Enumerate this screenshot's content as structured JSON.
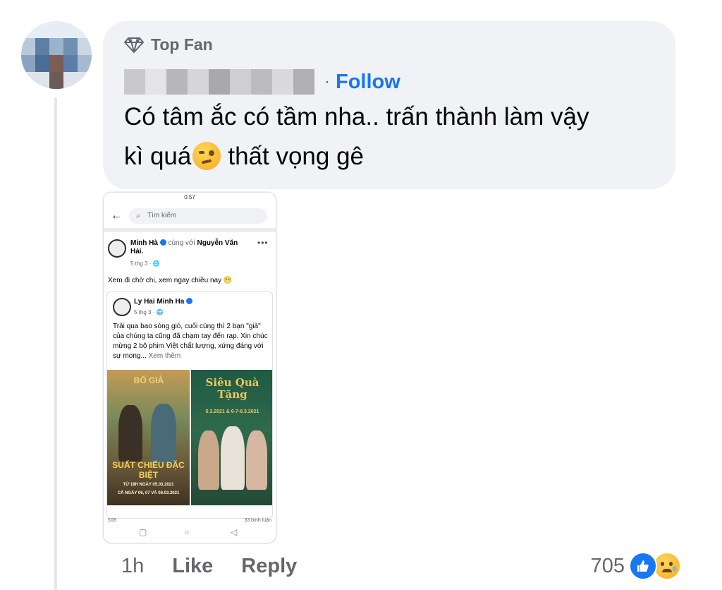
{
  "comment": {
    "badge": "Top Fan",
    "follow_label": "Follow",
    "separator": "·",
    "text_line1": "Có tâm ắc có tầm nha.. trấn thành làm vậy",
    "text_line2_before": "kì quá",
    "text_line2_after": "thất vọng gê",
    "emoji_icon": "woozy-face-icon"
  },
  "attachment": {
    "status_time": "0:57",
    "search_placeholder": "Tìm kiếm",
    "post": {
      "author": "Minh Hà",
      "with_text": "cùng với",
      "tagged": "Nguyễn Văn Hải.",
      "date": "5 thg 3 · ",
      "body": "Xem đi chờ chi, xem ngay chiều nay 😁"
    },
    "shared": {
      "author": "Ly Hai Minh Ha",
      "date": "5 thg 3 · ",
      "body": "Trải qua bao sóng gió, cuối cùng thì 2 bạn \"già\" của chúng ta cũng đã chạm tay đến rạp. Xin chúc mừng 2 bộ phim Việt chất lượng, xứng đáng với sự mong...",
      "see_more": "Xem thêm",
      "poster1_title": "BỐ GIÀ",
      "poster1_caption": "SUẤT CHIẾU ĐẶC BIỆT",
      "poster1_dates": "TỪ 18H NGÀY 05.03.2021",
      "poster1_dates2": "CẢ NGÀY 06, 07 VÀ 08.03.2021",
      "poster2_title": "Siêu Quà Tặng",
      "poster2_dates": "5.3.2021 & 6-7-8.3.2021"
    },
    "reaction_count": "508",
    "comment_count": "33 bình luận"
  },
  "footer": {
    "time": "1h",
    "like_label": "Like",
    "reply_label": "Reply",
    "reaction_total": "705"
  },
  "colors": {
    "follow": "#1877f2",
    "bubble": "#f0f2f5",
    "secondary_text": "#65676b"
  }
}
